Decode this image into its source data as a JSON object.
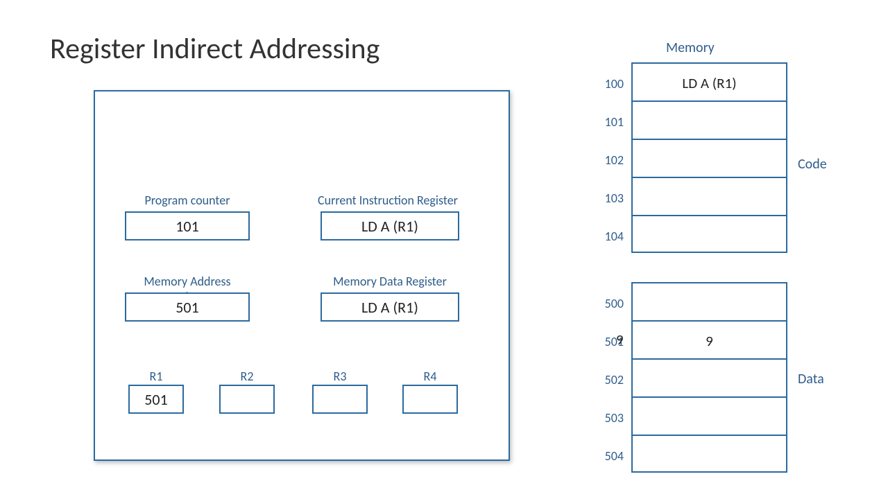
{
  "title": "Register Indirect Addressing",
  "cpu": {
    "pc": {
      "label": "Program counter",
      "value": "101"
    },
    "cir": {
      "label": "Current Instruction Register",
      "value": "LD   A   (R1)"
    },
    "mar": {
      "label": "Memory Address Register",
      "value": "501"
    },
    "mdr": {
      "label": "Memory Data Register",
      "value": "LD   A   (R1)"
    },
    "r1": {
      "label": "R1",
      "value": "501"
    },
    "r2": {
      "label": "R2",
      "value": ""
    },
    "r3": {
      "label": "R3",
      "value": ""
    },
    "r4": {
      "label": "R4",
      "value": ""
    }
  },
  "memory": {
    "title": "Memory",
    "code_label": "Code",
    "data_label": "Data",
    "code": [
      {
        "addr": "100",
        "value": "LD   A   (R1)"
      },
      {
        "addr": "101",
        "value": ""
      },
      {
        "addr": "102",
        "value": ""
      },
      {
        "addr": "103",
        "value": ""
      },
      {
        "addr": "104",
        "value": ""
      }
    ],
    "data": [
      {
        "addr": "500",
        "value": ""
      },
      {
        "addr": "501",
        "value": "9"
      },
      {
        "addr": "502",
        "value": ""
      },
      {
        "addr": "503",
        "value": ""
      },
      {
        "addr": "504",
        "value": ""
      }
    ]
  },
  "floating_value": "9"
}
